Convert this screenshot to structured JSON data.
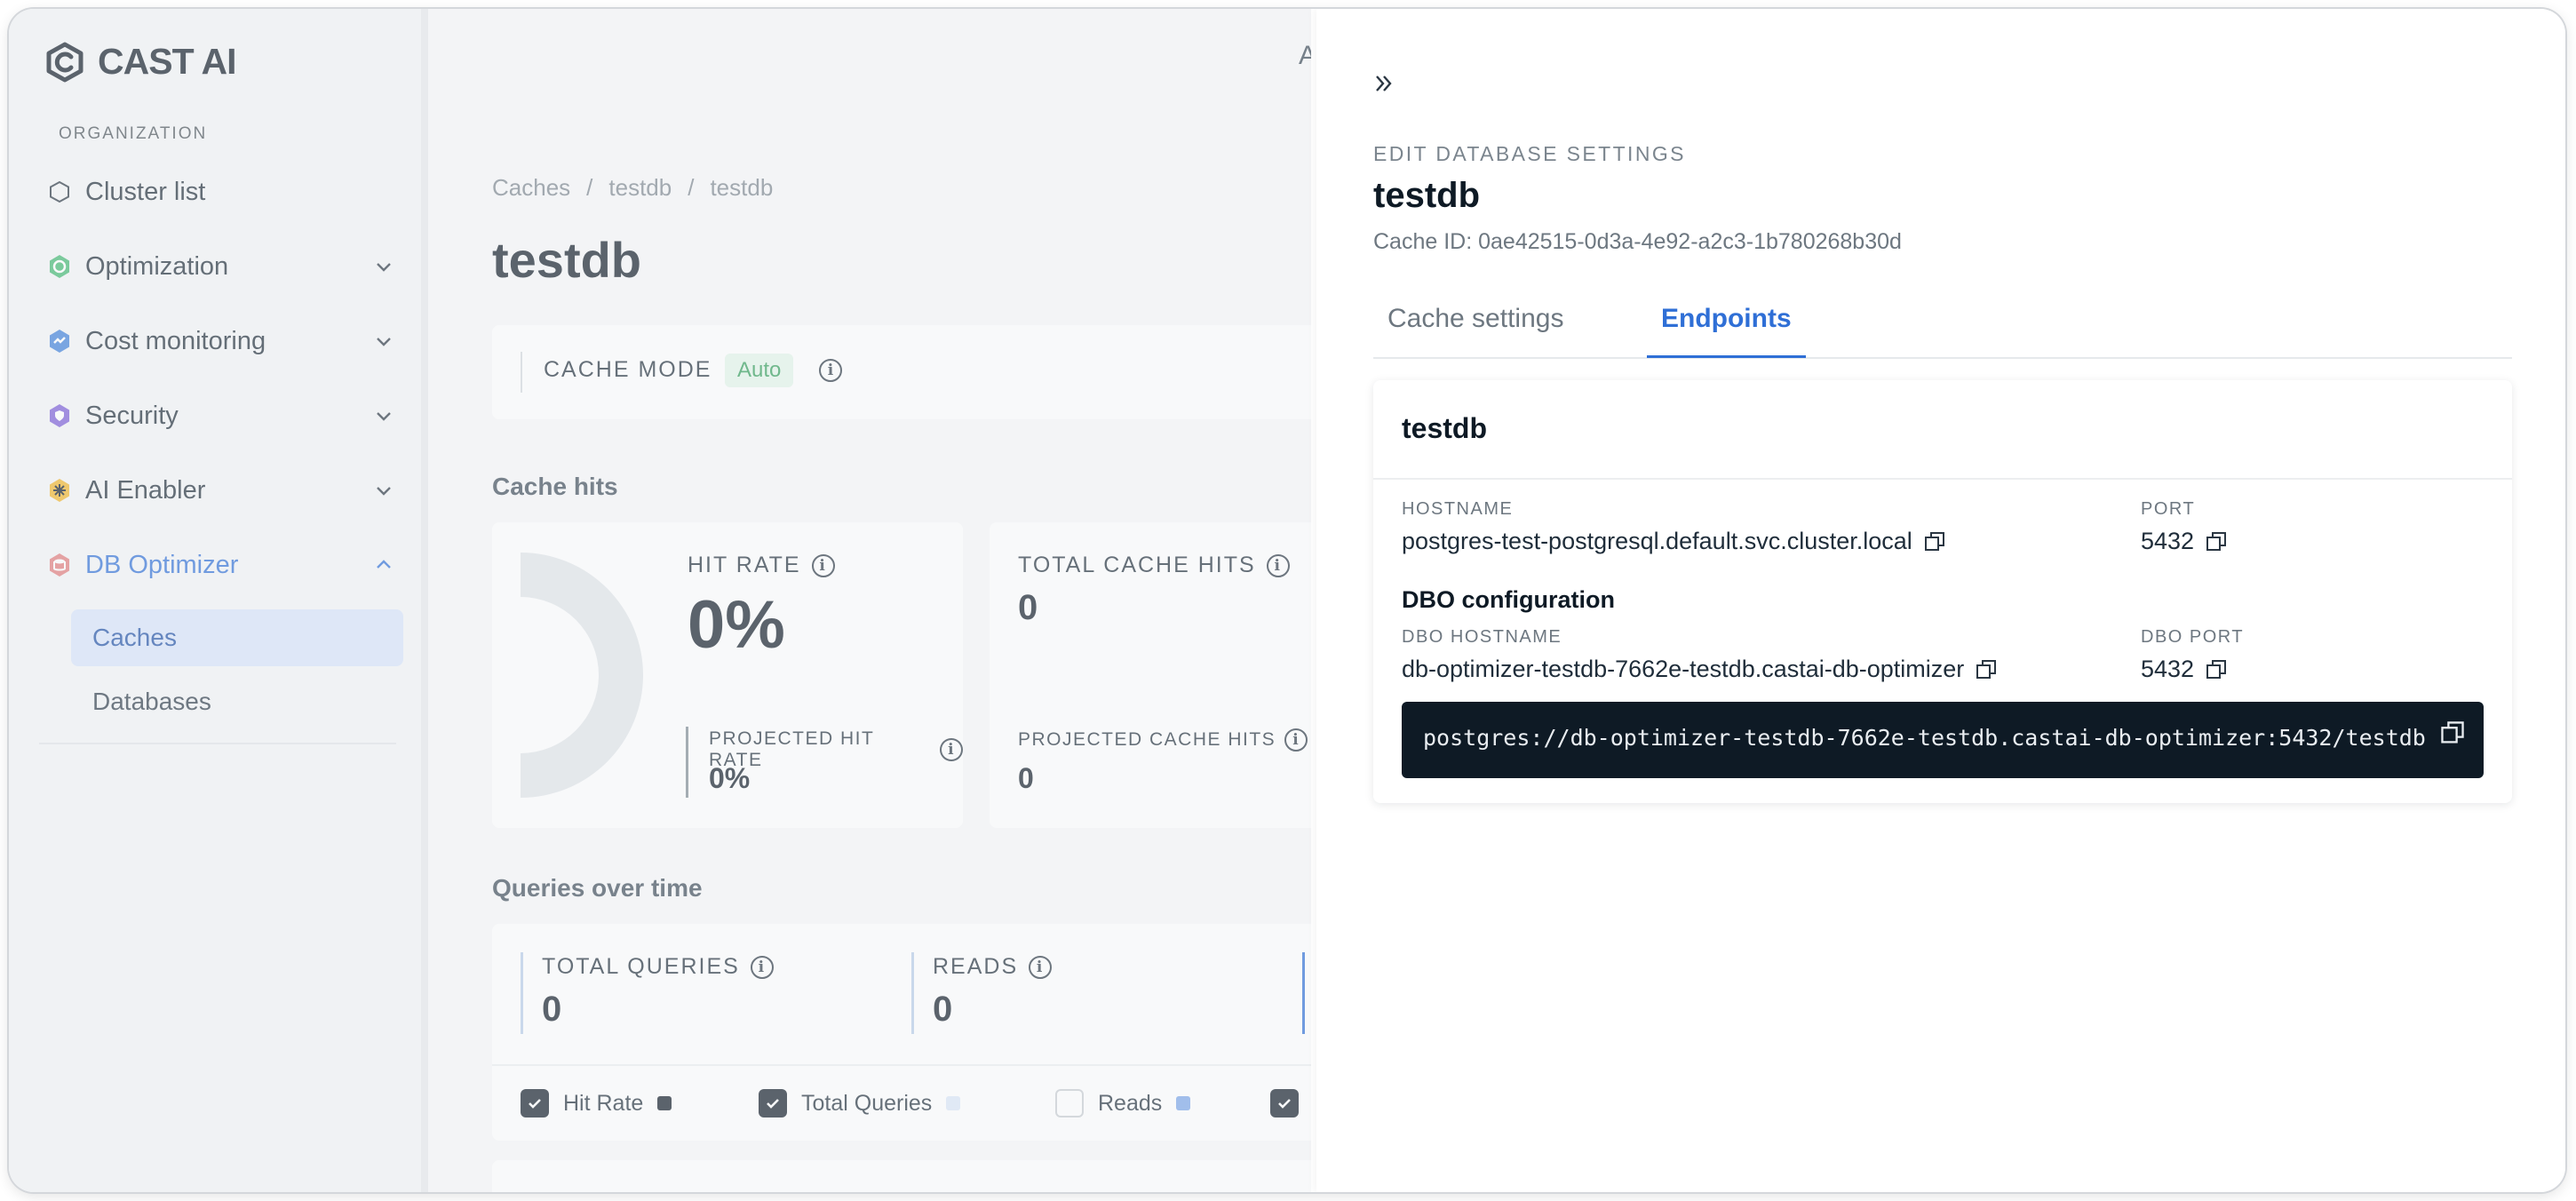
{
  "brand": {
    "name": "CAST AI"
  },
  "sidebar": {
    "section_label": "ORGANIZATION",
    "items": [
      {
        "label": "Cluster list",
        "icon": "hexagon-icon"
      },
      {
        "label": "Optimization",
        "icon": "optimization-icon"
      },
      {
        "label": "Cost monitoring",
        "icon": "cost-monitoring-icon"
      },
      {
        "label": "Security",
        "icon": "security-icon"
      },
      {
        "label": "AI Enabler",
        "icon": "ai-enabler-icon"
      },
      {
        "label": "DB Optimizer",
        "icon": "db-optimizer-icon"
      }
    ],
    "sub_items": [
      {
        "label": "Caches"
      },
      {
        "label": "Databases"
      }
    ]
  },
  "main": {
    "top_cut_text": "Ac",
    "breadcrumb": [
      "Caches",
      "testdb",
      "testdb"
    ],
    "breadcrumb_sep": "/",
    "title": "testdb",
    "cache_mode": {
      "label": "CACHE MODE",
      "value": "Auto"
    },
    "cache_hits": {
      "section_title": "Cache hits",
      "hit_rate_label": "HIT RATE",
      "hit_rate_value": "0%",
      "projected_hit_rate_label": "PROJECTED HIT RATE",
      "projected_hit_rate_value": "0%",
      "total_cache_hits_label": "TOTAL CACHE HITS",
      "total_cache_hits_value": "0",
      "projected_cache_hits_label": "PROJECTED CACHE HITS",
      "projected_cache_hits_value": "0"
    },
    "queries": {
      "section_title": "Queries over time",
      "total_queries_label": "TOTAL QUERIES",
      "total_queries_value": "0",
      "reads_label": "READS",
      "reads_value": "0",
      "legend": [
        {
          "label": "Hit Rate",
          "checked": true,
          "color": "#0e1a25"
        },
        {
          "label": "Total Queries",
          "checked": true,
          "color": "#dbe6f7"
        },
        {
          "label": "Reads",
          "checked": false,
          "color": "#7aa5e8"
        }
      ]
    }
  },
  "drawer": {
    "kicker": "EDIT DATABASE SETTINGS",
    "title": "testdb",
    "cache_id": "Cache ID: 0ae42515-0d3a-4e92-a2c3-1b780268b30d",
    "tabs": [
      {
        "label": "Cache settings",
        "active": false
      },
      {
        "label": "Endpoints",
        "active": true
      }
    ],
    "endpoint": {
      "title": "testdb",
      "hostname_label": "HOSTNAME",
      "hostname": "postgres-test-postgresql.default.svc.cluster.local",
      "port_label": "PORT",
      "port": "5432",
      "dbo_section": "DBO configuration",
      "dbo_hostname_label": "DBO HOSTNAME",
      "dbo_hostname": "db-optimizer-testdb-7662e-testdb.castai-db-optimizer",
      "dbo_port_label": "DBO PORT",
      "dbo_port": "5432",
      "connection_string": "postgres://db-optimizer-testdb-7662e-testdb.castai-db-optimizer:5432/testdb"
    }
  },
  "colors": {
    "accent": "#2f6fd6",
    "dark": "#0e1a25",
    "success": "#2e9b57"
  }
}
